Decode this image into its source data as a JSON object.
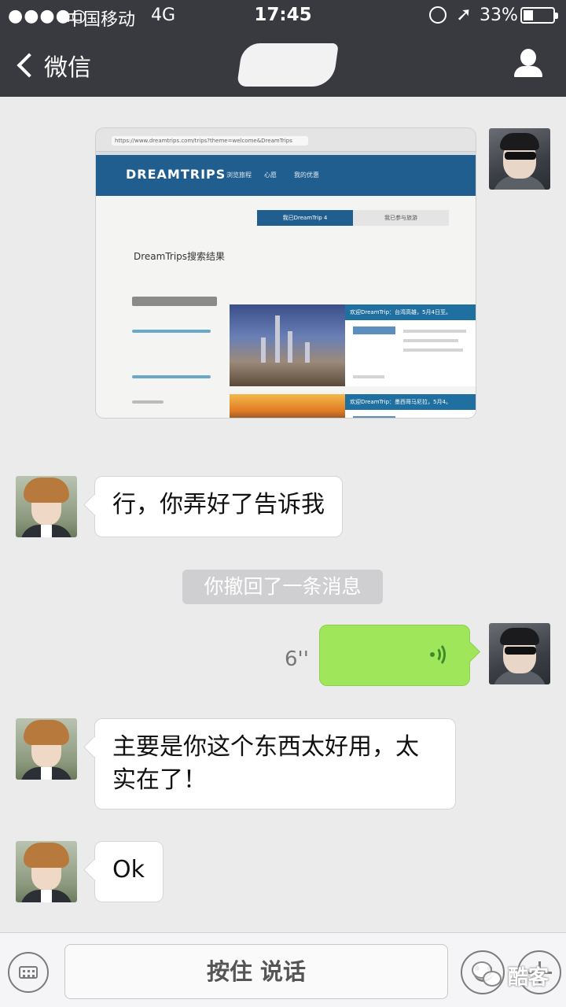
{
  "status_bar": {
    "signal": "●●●●○",
    "carrier": "中国移动",
    "network": "4G",
    "time": "17:45",
    "location_icon": "location-arrow-icon",
    "battery_percent": "33%",
    "battery_level": 0.33
  },
  "nav": {
    "back_label": "微信",
    "title": "",
    "profile_icon": "person-icon"
  },
  "screenshot_content": {
    "url": "https://www.dreamtrips.com/trips?theme=welcome&DreamTrips",
    "logo": "DREAMTRIPS",
    "menu": [
      "浏览旅程",
      "心愿",
      "我的优惠"
    ],
    "tab_active": "我已DreamTrip 4",
    "tab_inactive": "我已参与旅游",
    "heading": "DreamTrips搜索结果",
    "card1_title": "欢迎DreamTrip：台湾高雄，5月4日至。",
    "card2_title": "欢迎DreamTrip：墨西哥马尼拉，5月4。"
  },
  "messages": {
    "m1_text": "行，你弄好了告诉我",
    "recall_notice": "你撤回了一条消息",
    "voice_duration": "6''",
    "m3_text": "主要是你这个东西太好用，太实在了！",
    "m4_text": "Ok"
  },
  "input_bar": {
    "talk_label": "按住 说话",
    "keyboard_icon": "keyboard-icon",
    "emoji_icon": "emoji-icon",
    "plus_icon": "plus-icon"
  },
  "watermark": {
    "text": "酷客"
  },
  "colors": {
    "header_bg": "#393a3f",
    "chat_bg": "#ebebeb",
    "voice_bubble": "#9fe65a"
  }
}
